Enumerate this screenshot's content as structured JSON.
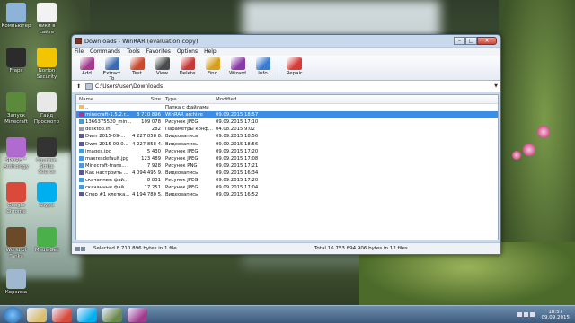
{
  "desktop": {
    "icons": [
      {
        "label": "Компьютер",
        "color": "#8db3d8"
      },
      {
        "label": "ники в сайте",
        "color": "#f2f2f2"
      },
      {
        "label": "Fraps",
        "color": "#2b2b2b"
      },
      {
        "label": "Norton Security",
        "color": "#f2c500"
      },
      {
        "label": "Запуск Minecraft",
        "color": "#5a8a3a"
      },
      {
        "label": "Гайд Просмотр",
        "color": "#e8e8e8"
      },
      {
        "label": "SPORE™ Anthology",
        "color": "#b06ad0"
      },
      {
        "label": "Counter-Strike Source",
        "color": "#333333"
      },
      {
        "label": "Google Chrome",
        "color": "#d94a3b"
      },
      {
        "label": "Skype",
        "color": "#00aff0"
      },
      {
        "label": "World of Tanks",
        "color": "#6b4a2a"
      },
      {
        "label": "MediaGet",
        "color": "#4ab04a"
      },
      {
        "label": "Корзина",
        "color": "#9fb8d0"
      }
    ]
  },
  "window": {
    "title": "Downloads - WinRAR (evaluation copy)",
    "menu": [
      "File",
      "Commands",
      "Tools",
      "Favorites",
      "Options",
      "Help"
    ],
    "toolbar": [
      {
        "label": "Add",
        "icon": "add-icon",
        "color": "#a23b8e"
      },
      {
        "label": "Extract To",
        "icon": "extract-icon",
        "color": "#3a6bb0"
      },
      {
        "label": "Test",
        "icon": "test-icon",
        "color": "#c94a2e"
      },
      {
        "label": "View",
        "icon": "view-icon",
        "color": "#4b4b4b"
      },
      {
        "label": "Delete",
        "icon": "delete-icon",
        "color": "#c83a3a"
      },
      {
        "label": "Find",
        "icon": "find-icon",
        "color": "#d8a020"
      },
      {
        "label": "Wizard",
        "icon": "wizard-icon",
        "color": "#8a3aa8"
      },
      {
        "label": "Info",
        "icon": "info-icon",
        "color": "#3a7ad0"
      },
      {
        "label": "Repair",
        "icon": "repair-icon",
        "color": "#d83a3a"
      }
    ],
    "address": "C:\\Users\\user\\Downloads",
    "columns": {
      "name": "Name",
      "size": "Size",
      "type": "Type",
      "modified": "Modified"
    },
    "files": [
      {
        "name": "..",
        "size": "",
        "type": "Папка с файлами",
        "modified": "",
        "icon": "folder",
        "selected": false
      },
      {
        "name": "minecraft-1.5.2.r...",
        "size": "8 710 896",
        "type": "WinRAR archive",
        "modified": "09.09.2015 18:57",
        "icon": "rar",
        "selected": true
      },
      {
        "name": "1366375520_min...",
        "size": "109 078",
        "type": "Рисунок JPEG",
        "modified": "09.09.2015 17:10",
        "icon": "img",
        "selected": false
      },
      {
        "name": "desktop.ini",
        "size": "282",
        "type": "Параметры конф...",
        "modified": "04.08.2015 9:02",
        "icon": "ini",
        "selected": false
      },
      {
        "name": "Dwm 2015-09-...",
        "size": "4 227 858 8...",
        "type": "Видеозапись",
        "modified": "09.09.2015 18:56",
        "icon": "video",
        "selected": false
      },
      {
        "name": "Dwm 2015-09-0...",
        "size": "4 227 858 4...",
        "type": "Видеозапись",
        "modified": "09.09.2015 18:56",
        "icon": "video",
        "selected": false
      },
      {
        "name": "images.jpg",
        "size": "5 430",
        "type": "Рисунок JPEG",
        "modified": "09.09.2015 17:20",
        "icon": "img",
        "selected": false
      },
      {
        "name": "maxresdefault.jpg",
        "size": "123 489",
        "type": "Рисунок JPEG",
        "modified": "09.09.2015 17:08",
        "icon": "img",
        "selected": false
      },
      {
        "name": "Minecraft-trans...",
        "size": "7 928",
        "type": "Рисунок PNG",
        "modified": "09.09.2015 17:21",
        "icon": "img",
        "selected": false
      },
      {
        "name": "Как настроить ...",
        "size": "4 094 495 9...",
        "type": "Видеозапись",
        "modified": "09.09.2015 16:34",
        "icon": "video",
        "selected": false
      },
      {
        "name": "скачанные фай...",
        "size": "8 831",
        "type": "Рисунок JPEG",
        "modified": "09.09.2015 17:20",
        "icon": "img",
        "selected": false
      },
      {
        "name": "скачанные фай...",
        "size": "17 251",
        "type": "Рисунок JPEG",
        "modified": "09.09.2015 17:04",
        "icon": "img",
        "selected": false
      },
      {
        "name": "Спор #1 клетка...",
        "size": "4 194 780 5...",
        "type": "Видеозапись",
        "modified": "09.09.2015 16:52",
        "icon": "video",
        "selected": false
      }
    ],
    "status_left": "Selected 8 710 896 bytes in 1 file",
    "status_right": "Total 16 753 894 906 bytes in 12 files"
  },
  "taskbar": {
    "time": "18:57",
    "date": "09.09.2015",
    "items": [
      {
        "name": "explorer",
        "color": "#d8c070"
      },
      {
        "name": "chrome",
        "color": "#d94a3b"
      },
      {
        "name": "skype",
        "color": "#00aff0"
      },
      {
        "name": "minecraft",
        "color": "#6a8a4a"
      },
      {
        "name": "winrar",
        "color": "#a23b8e"
      }
    ]
  },
  "icon_colors": {
    "folder": "#e8c060",
    "rar": "#a23b8e",
    "img": "#4a9ad8",
    "ini": "#9a9a9a",
    "video": "#5a5a8a"
  }
}
